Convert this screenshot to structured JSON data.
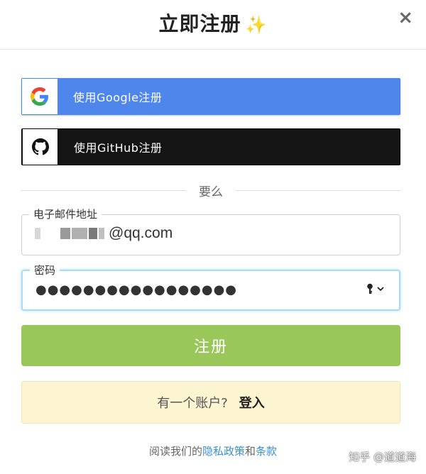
{
  "header": {
    "title": "立即注册",
    "sparkle": "✨",
    "close": "×"
  },
  "social": {
    "google_label": "使用Google注册",
    "github_label": "使用GitHub注册"
  },
  "divider": {
    "text": "要么"
  },
  "email": {
    "label": "电子邮件地址",
    "value_visible": "@qq.com"
  },
  "password": {
    "label": "密码",
    "masked_value": "●●●●●●●●●●●●●●●●●"
  },
  "submit": {
    "label": "注册"
  },
  "login": {
    "prompt": "有一个账户?",
    "link": "登入"
  },
  "footer": {
    "prefix": "阅读我们的",
    "privacy": "隐私政策",
    "and": "和",
    "terms": "条款"
  },
  "watermark": {
    "text": "知乎 @道道海"
  },
  "colors": {
    "google": "#4f86ec",
    "github": "#141414",
    "submit": "#9ac75a",
    "login_bg": "#fdf4d2",
    "link": "#3a8fd8"
  }
}
